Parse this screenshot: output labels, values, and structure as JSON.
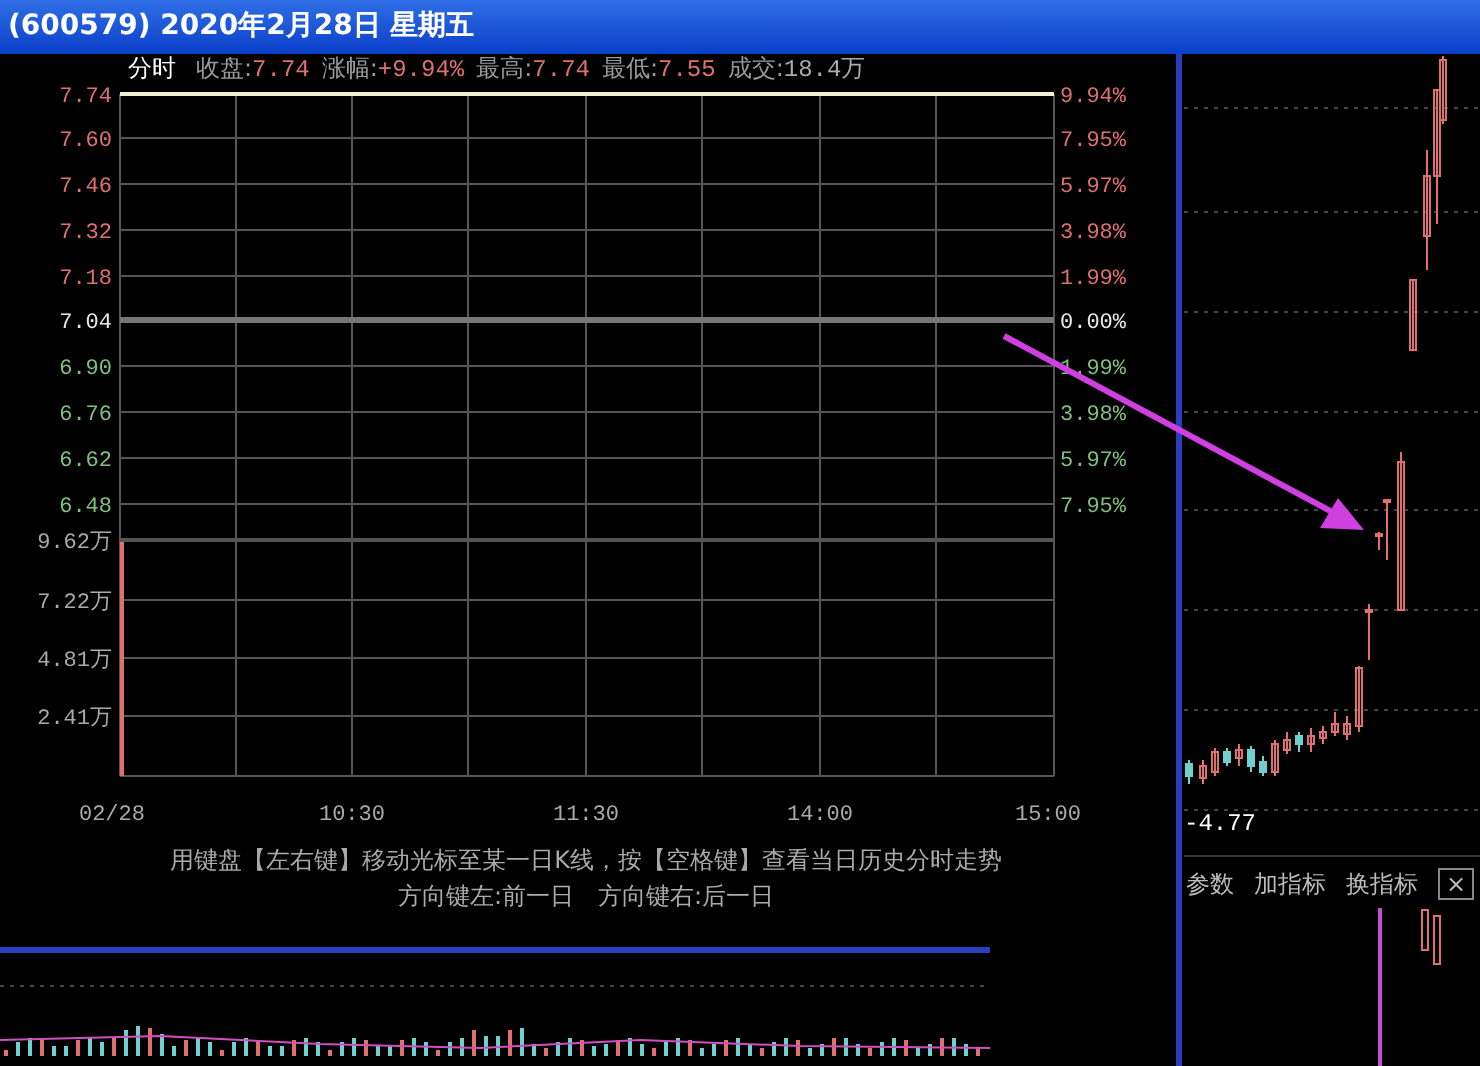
{
  "title": "(600579) 2020年2月28日 星期五",
  "quote": {
    "tab": "分时",
    "items": [
      {
        "label": "收盘:",
        "value": "7.74",
        "color": "#e07070"
      },
      {
        "label": "涨幅:",
        "value": "+9.94%",
        "color": "#e07070"
      },
      {
        "label": "最高:",
        "value": "7.74",
        "color": "#e07070"
      },
      {
        "label": "最低:",
        "value": "7.55",
        "color": "#e07070"
      },
      {
        "label": "成交:",
        "value": "18.4万",
        "color": "#aaaaaa"
      }
    ]
  },
  "price_axis": [
    {
      "label": "7.74",
      "color": "#e07070"
    },
    {
      "label": "7.60",
      "color": "#e07070"
    },
    {
      "label": "7.46",
      "color": "#e07070"
    },
    {
      "label": "7.32",
      "color": "#e07070"
    },
    {
      "label": "7.18",
      "color": "#e07070"
    },
    {
      "label": "7.04",
      "color": "#e8e8e8"
    },
    {
      "label": "6.90",
      "color": "#7fc07f"
    },
    {
      "label": "6.76",
      "color": "#7fc07f"
    },
    {
      "label": "6.62",
      "color": "#7fc07f"
    },
    {
      "label": "6.48",
      "color": "#7fc07f"
    }
  ],
  "percent_axis": [
    {
      "label": "9.94%",
      "color": "#e07070"
    },
    {
      "label": "7.95%",
      "color": "#e07070"
    },
    {
      "label": "5.97%",
      "color": "#e07070"
    },
    {
      "label": "3.98%",
      "color": "#e07070"
    },
    {
      "label": "1.99%",
      "color": "#e07070"
    },
    {
      "label": "0.00%",
      "color": "#e8e8e8"
    },
    {
      "label": "1.99%",
      "color": "#7fc07f"
    },
    {
      "label": "3.98%",
      "color": "#7fc07f"
    },
    {
      "label": "5.97%",
      "color": "#7fc07f"
    },
    {
      "label": "7.95%",
      "color": "#7fc07f"
    }
  ],
  "volume_axis": [
    "9.62万",
    "7.22万",
    "4.81万",
    "2.41万"
  ],
  "time_axis": [
    "02/28",
    "10:30",
    "11:30",
    "14:00",
    "15:00"
  ],
  "hint_lines": [
    "用键盘【左右键】移动光标至某一日K线，按【空格键】查看当日历史分时走势",
    "方向键左:前一日　方向键右:后一日"
  ],
  "side_panel": {
    "reading": "-4.77",
    "tools": [
      "参数",
      "加指标",
      "换指标"
    ],
    "close": "×"
  }
}
